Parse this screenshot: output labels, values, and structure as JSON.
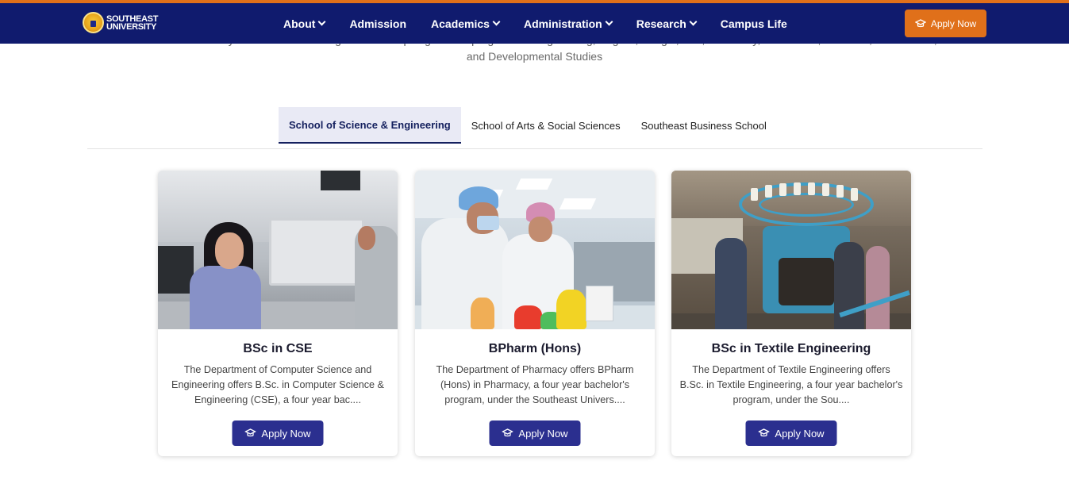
{
  "header": {
    "logo_line1": "SOUTHEAST",
    "logo_line2": "UNIVERSITY",
    "nav": [
      {
        "label": "About",
        "has_dropdown": true
      },
      {
        "label": "Admission",
        "has_dropdown": false
      },
      {
        "label": "Academics",
        "has_dropdown": true
      },
      {
        "label": "Administration",
        "has_dropdown": true
      },
      {
        "label": "Research",
        "has_dropdown": true
      },
      {
        "label": "Campus Life",
        "has_dropdown": false
      }
    ],
    "apply_label": "Apply Now",
    "colors": {
      "bar": "#101b6e",
      "accent": "#e0701a"
    }
  },
  "intro": {
    "cut_line": "Southeast University offers several undergraduate and postgraduate programs in Engineering, English, Bangla, Law, Pharmacy, Economics, Business, Architecture,",
    "last_line": "and Developmental Studies"
  },
  "tabs": [
    {
      "label": "School of Science & Engineering",
      "active": true
    },
    {
      "label": "School of Arts & Social Sciences",
      "active": false
    },
    {
      "label": "Southeast Business School",
      "active": false
    }
  ],
  "programs": [
    {
      "title": "BSc in CSE",
      "description": "The Department of Computer Science and Engineering offers B.Sc. in Computer Science & Engineering (CSE), a four year bac....",
      "button": "Apply Now"
    },
    {
      "title": "BPharm (Hons)",
      "description": "The Department of Pharmacy offers BPharm (Hons) in Pharmacy, a four year bachelor's program, under the Southeast Univers....",
      "button": "Apply Now"
    },
    {
      "title": "BSc in Textile Engineering",
      "description": "The Department of Textile Engineering offers B.Sc. in Textile Engineering, a four year bachelor's program, under the Sou....",
      "button": "Apply Now"
    }
  ],
  "icons": {
    "apply": "graduation-cap-icon",
    "dropdown": "chevron-down-icon"
  }
}
